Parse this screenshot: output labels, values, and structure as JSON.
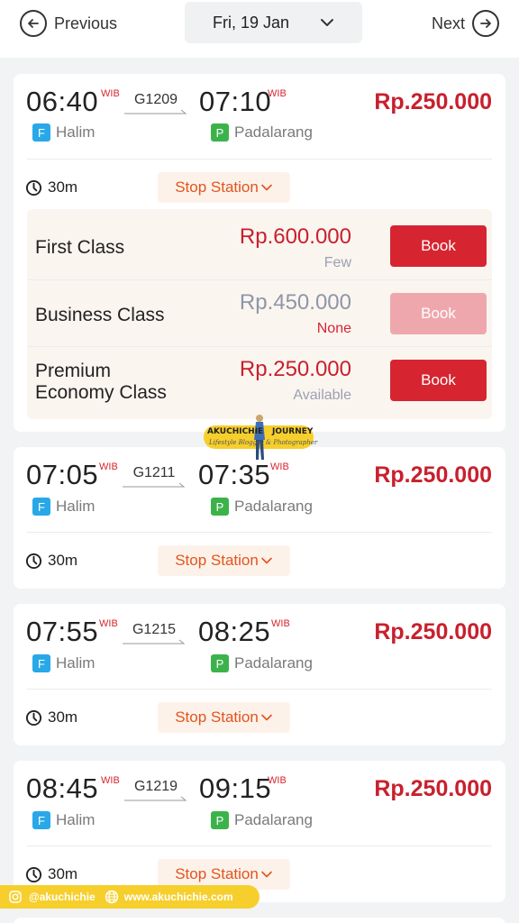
{
  "header": {
    "prev_label": "Previous",
    "date": "Fri, 19 Jan",
    "next_label": "Next"
  },
  "trips": [
    {
      "depart_time": "06:40",
      "depart_tz": "WIB",
      "train": "G1209",
      "arrive_time": "07:10",
      "arrive_tz": "WIB",
      "price": "Rp.250.000",
      "origin_badge": "F",
      "origin": "Halim",
      "dest_badge": "P",
      "dest": "Padalarang",
      "duration": "30m",
      "stop_label": "Stop Station",
      "classes": [
        {
          "name": "First Class",
          "price": "Rp.600.000",
          "availability": "Few",
          "book_label": "Book",
          "enabled": true
        },
        {
          "name": "Business Class",
          "price": "Rp.450.000",
          "availability": "None",
          "book_label": "Book",
          "enabled": false
        },
        {
          "name": "Premium Economy Class",
          "name_line1": "Premium",
          "name_line2": "Economy Class",
          "price": "Rp.250.000",
          "availability": "Available",
          "book_label": "Book",
          "enabled": true
        }
      ]
    },
    {
      "depart_time": "07:05",
      "depart_tz": "WIB",
      "train": "G1211",
      "arrive_time": "07:35",
      "arrive_tz": "WIB",
      "price": "Rp.250.000",
      "origin_badge": "F",
      "origin": "Halim",
      "dest_badge": "P",
      "dest": "Padalarang",
      "duration": "30m",
      "stop_label": "Stop Station"
    },
    {
      "depart_time": "07:55",
      "depart_tz": "WIB",
      "train": "G1215",
      "arrive_time": "08:25",
      "arrive_tz": "WIB",
      "price": "Rp.250.000",
      "origin_badge": "F",
      "origin": "Halim",
      "dest_badge": "P",
      "dest": "Padalarang",
      "duration": "30m",
      "stop_label": "Stop Station"
    },
    {
      "depart_time": "08:45",
      "depart_tz": "WIB",
      "train": "G1219",
      "arrive_time": "09:15",
      "arrive_tz": "WIB",
      "price": "Rp.250.000",
      "origin_badge": "F",
      "origin": "Halim",
      "dest_badge": "P",
      "dest": "Padalarang",
      "duration": "30m",
      "stop_label": "Stop Station"
    }
  ],
  "watermark": {
    "brand_left": "AKUCHICHIE",
    "brand_right": "JOURNEY",
    "tagline": "Lifestyle Blogger & Photographer"
  },
  "social": {
    "instagram": "@akuchichie",
    "website": "www.akuchichie.com"
  },
  "colors": {
    "accent_red": "#d62530",
    "price_red": "#c8202d",
    "disabled_book": "#eea8ad",
    "stop_orange": "#e2541d",
    "halim_badge": "#29a8e8",
    "padalarang_badge": "#3cb34a",
    "watermark_yellow": "#f6cf2c"
  },
  "icons": [
    "arrow-left-circle-icon",
    "chevron-down-icon",
    "arrow-right-circle-icon",
    "clock-icon",
    "instagram-icon",
    "globe-icon"
  ]
}
